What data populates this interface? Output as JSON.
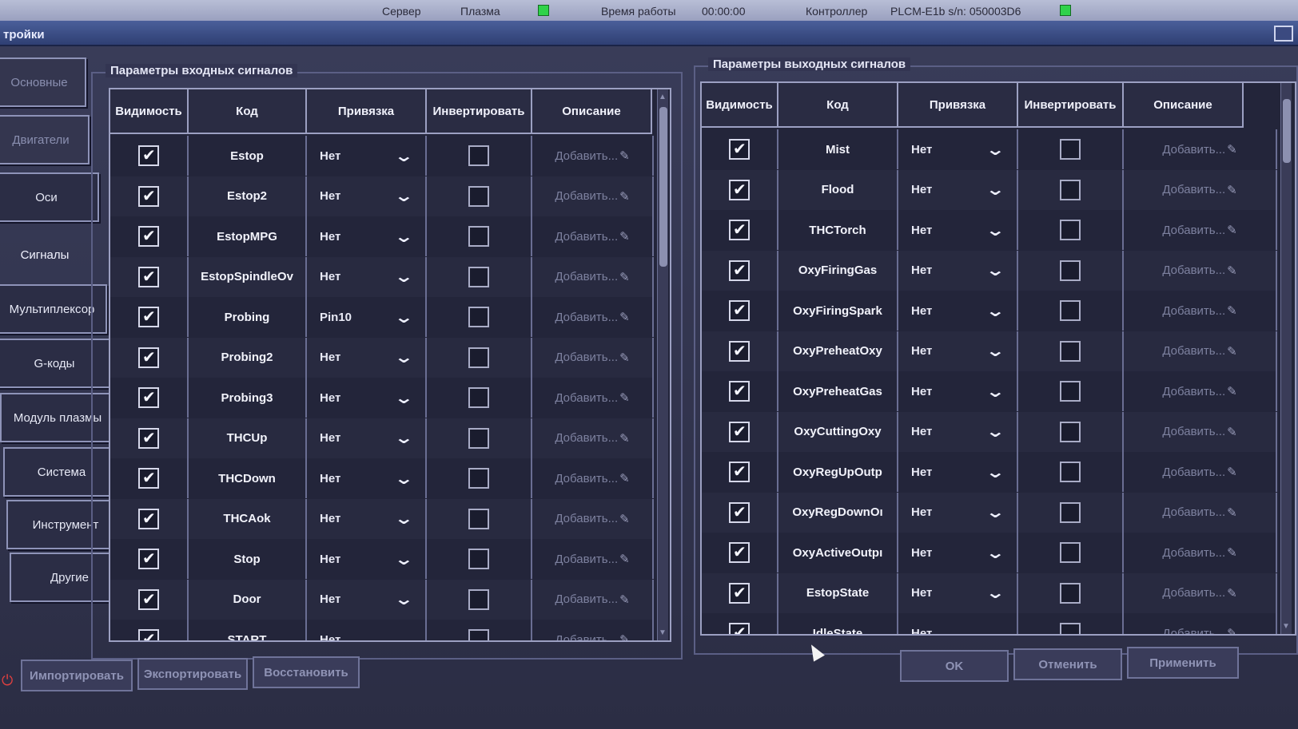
{
  "statusbar": {
    "server": "Сервер",
    "plasma": "Плазма",
    "runtime_label": "Время работы",
    "runtime": "00:00:00",
    "controller_label": "Контроллер",
    "controller": "PLCM-E1b s/n: 050003D6"
  },
  "window": {
    "title": "тройки"
  },
  "nav": [
    {
      "label": "Основные"
    },
    {
      "label": "Двигатели"
    },
    {
      "label": "Оси"
    },
    {
      "label": "Сигналы"
    },
    {
      "label": "Мультиплексор"
    },
    {
      "label": "G-коды"
    },
    {
      "label": "Модуль плазмы"
    },
    {
      "label": "Система"
    },
    {
      "label": "Инструмент"
    },
    {
      "label": "Другие"
    }
  ],
  "inputs": {
    "title": "Параметры входных сигналов",
    "headers": [
      "Видимость",
      "Код",
      "Привязка",
      "Инвертировать",
      "Описание"
    ],
    "rows": [
      {
        "visible": true,
        "code": "Estop",
        "binding": "Нет",
        "invert": false,
        "desc": "Добавить..."
      },
      {
        "visible": true,
        "code": "Estop2",
        "binding": "Нет",
        "invert": false,
        "desc": "Добавить..."
      },
      {
        "visible": true,
        "code": "EstopMPG",
        "binding": "Нет",
        "invert": false,
        "desc": "Добавить..."
      },
      {
        "visible": true,
        "code": "EstopSpindleOv",
        "binding": "Нет",
        "invert": false,
        "desc": "Добавить..."
      },
      {
        "visible": true,
        "code": "Probing",
        "binding": "Pin10",
        "invert": false,
        "desc": "Добавить..."
      },
      {
        "visible": true,
        "code": "Probing2",
        "binding": "Нет",
        "invert": false,
        "desc": "Добавить..."
      },
      {
        "visible": true,
        "code": "Probing3",
        "binding": "Нет",
        "invert": false,
        "desc": "Добавить..."
      },
      {
        "visible": true,
        "code": "THCUp",
        "binding": "Нет",
        "invert": false,
        "desc": "Добавить..."
      },
      {
        "visible": true,
        "code": "THCDown",
        "binding": "Нет",
        "invert": false,
        "desc": "Добавить..."
      },
      {
        "visible": true,
        "code": "THCAok",
        "binding": "Нет",
        "invert": false,
        "desc": "Добавить..."
      },
      {
        "visible": true,
        "code": "Stop",
        "binding": "Нет",
        "invert": false,
        "desc": "Добавить..."
      },
      {
        "visible": true,
        "code": "Door",
        "binding": "Нет",
        "invert": false,
        "desc": "Добавить..."
      },
      {
        "visible": true,
        "code": "START",
        "binding": "Нет",
        "invert": false,
        "desc": "Добавить..."
      }
    ]
  },
  "outputs": {
    "title": "Параметры выходных сигналов",
    "headers": [
      "Видимость",
      "Код",
      "Привязка",
      "Инвертировать",
      "Описание"
    ],
    "rows": [
      {
        "visible": true,
        "code": "Mist",
        "binding": "Нет",
        "invert": false,
        "desc": "Добавить..."
      },
      {
        "visible": true,
        "code": "Flood",
        "binding": "Нет",
        "invert": false,
        "desc": "Добавить..."
      },
      {
        "visible": true,
        "code": "THCTorch",
        "binding": "Нет",
        "invert": false,
        "desc": "Добавить..."
      },
      {
        "visible": true,
        "code": "OxyFiringGas",
        "binding": "Нет",
        "invert": false,
        "desc": "Добавить..."
      },
      {
        "visible": true,
        "code": "OxyFiringSpark",
        "binding": "Нет",
        "invert": false,
        "desc": "Добавить..."
      },
      {
        "visible": true,
        "code": "OxyPreheatOxy",
        "binding": "Нет",
        "invert": false,
        "desc": "Добавить..."
      },
      {
        "visible": true,
        "code": "OxyPreheatGas",
        "binding": "Нет",
        "invert": false,
        "desc": "Добавить..."
      },
      {
        "visible": true,
        "code": "OxyCuttingOxy",
        "binding": "Нет",
        "invert": false,
        "desc": "Добавить..."
      },
      {
        "visible": true,
        "code": "OxyRegUpOutp",
        "binding": "Нет",
        "invert": false,
        "desc": "Добавить..."
      },
      {
        "visible": true,
        "code": "OxyRegDownOı",
        "binding": "Нет",
        "invert": false,
        "desc": "Добавить..."
      },
      {
        "visible": true,
        "code": "OxyActiveOutpı",
        "binding": "Нет",
        "invert": false,
        "desc": "Добавить..."
      },
      {
        "visible": true,
        "code": "EstopState",
        "binding": "Нет",
        "invert": false,
        "desc": "Добавить..."
      },
      {
        "visible": true,
        "code": "IdleState",
        "binding": "Нет",
        "invert": false,
        "desc": "Добавить..."
      }
    ]
  },
  "footer": {
    "import": "Импортировать",
    "export": "Экспортировать",
    "restore": "Восстановить",
    "ok": "OK",
    "cancel": "Отменить",
    "apply": "Применить"
  }
}
